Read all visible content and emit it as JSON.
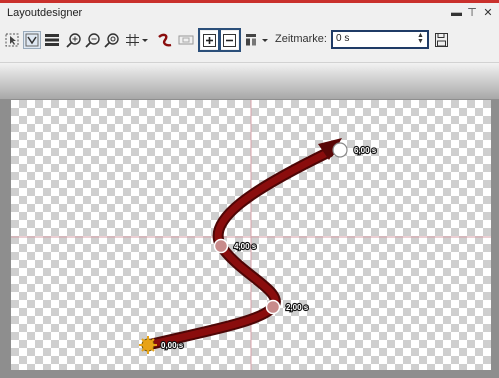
{
  "window": {
    "title": "Layoutdesigner",
    "controls": [
      "▬",
      "⊤",
      "✕"
    ]
  },
  "toolbar": {
    "tools": [
      "select-icon",
      "path-edit-icon",
      "list-icon",
      "zoom-in-icon",
      "zoom-out-icon",
      "zoom-fit-icon",
      "grid-icon",
      "curve-icon",
      "film-icon",
      "add-keyframe-icon",
      "remove-keyframe-icon",
      "align-icon"
    ],
    "zeitmarke_label": "Zeitmarke:",
    "zeitmarke_value": "0 s"
  },
  "path": {
    "keyframes": [
      {
        "label": "0,00 s"
      },
      {
        "label": "2,00 s"
      },
      {
        "label": "4,00 s"
      },
      {
        "label": "6,00 s"
      }
    ],
    "path_color": "#8a0d0d",
    "start_marker_color": "#e8a317"
  }
}
